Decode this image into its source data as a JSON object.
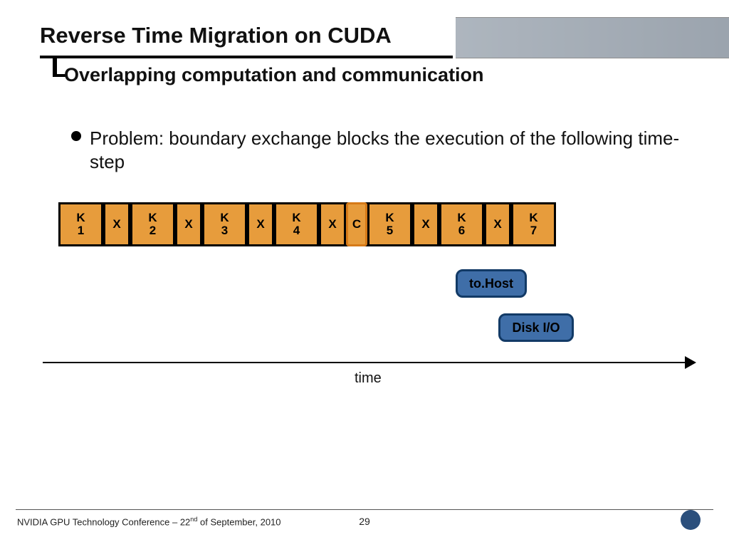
{
  "title": "Reverse Time Migration on CUDA",
  "subtitle": "Overlapping computation and communication",
  "body": "Problem: boundary exchange blocks the execution of the following time-step",
  "timeline": [
    {
      "kind": "k",
      "label": "K\n1"
    },
    {
      "kind": "x",
      "label": "X"
    },
    {
      "kind": "k",
      "label": "K\n2"
    },
    {
      "kind": "x",
      "label": "X"
    },
    {
      "kind": "k",
      "label": "K\n3"
    },
    {
      "kind": "x",
      "label": "X"
    },
    {
      "kind": "k",
      "label": "K\n4"
    },
    {
      "kind": "x",
      "label": "X"
    },
    {
      "kind": "c",
      "label": "C"
    },
    {
      "kind": "k",
      "label": "K\n5"
    },
    {
      "kind": "x",
      "label": "X"
    },
    {
      "kind": "k",
      "label": "K\n6"
    },
    {
      "kind": "x",
      "label": "X"
    },
    {
      "kind": "k",
      "label": "K\n7"
    }
  ],
  "pill_tohost": "to.Host",
  "pill_diskio": "Disk I/O",
  "time_label": "time",
  "footer_left_prefix": "NVIDIA GPU Technology Conference – 22",
  "footer_left_suffix": " of September, 2010",
  "footer_left_ord": "nd",
  "page_number": "29"
}
